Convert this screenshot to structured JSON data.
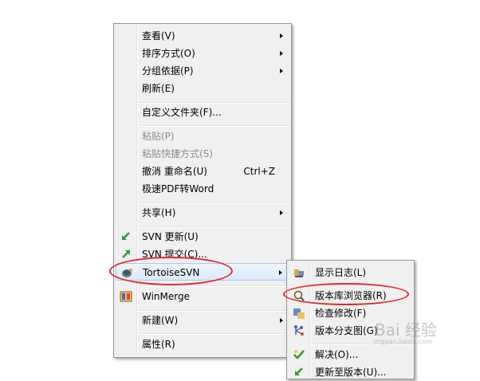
{
  "context_menu": {
    "items": [
      {
        "label": "查看(V)",
        "submenu": true
      },
      {
        "label": "排序方式(O)",
        "submenu": true
      },
      {
        "label": "分组依据(P)",
        "submenu": true
      },
      {
        "label": "刷新(E)"
      },
      {
        "label": "自定义文件夹(F)..."
      },
      {
        "label": "粘贴(P)",
        "disabled": true
      },
      {
        "label": "粘贴快捷方式(S)",
        "disabled": true
      },
      {
        "label": "撤消 重命名(U)",
        "shortcut": "Ctrl+Z"
      },
      {
        "label": "极速PDF转Word"
      },
      {
        "label": "共享(H)",
        "submenu": true
      },
      {
        "label": "SVN 更新(U)",
        "icon": "svn-update-icon"
      },
      {
        "label": "SVN 提交(C)...",
        "icon": "svn-commit-icon"
      },
      {
        "label": "TortoiseSVN",
        "icon": "tortoisesvn-icon",
        "submenu": true,
        "highlighted": true
      },
      {
        "label": "WinMerge",
        "icon": "winmerge-icon"
      },
      {
        "label": "新建(W)",
        "submenu": true
      },
      {
        "label": "属性(R)"
      }
    ]
  },
  "submenu": {
    "items": [
      {
        "label": "显示日志(L)",
        "icon": "show-log-icon"
      },
      {
        "label": "版本库浏览器(R)",
        "icon": "repo-browser-icon"
      },
      {
        "label": "检查修改(F)",
        "icon": "check-modifications-icon"
      },
      {
        "label": "版本分支图(G)",
        "icon": "revision-graph-icon"
      },
      {
        "label": "解决(O)...",
        "icon": "resolve-icon"
      },
      {
        "label": "更新至版本(U)...",
        "icon": "update-revision-icon"
      }
    ]
  },
  "watermark": {
    "text": "Bai 经验",
    "subtext": "jingyan.baidu.com"
  },
  "annotation_color": "#e0292b"
}
